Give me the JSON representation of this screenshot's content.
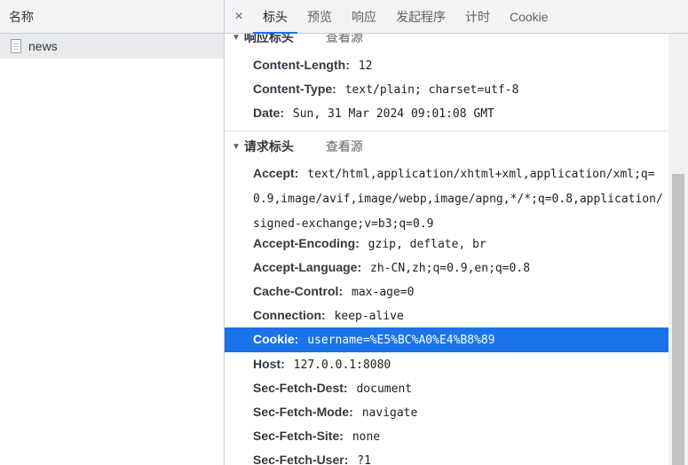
{
  "left": {
    "header": "名称",
    "items": [
      {
        "name": "news",
        "icon": "document-icon"
      }
    ]
  },
  "tabs": {
    "close": "×",
    "items": [
      "标头",
      "预览",
      "响应",
      "发起程序",
      "计时",
      "Cookie"
    ],
    "active": "标头"
  },
  "response_headers": {
    "title": "响应标头",
    "view_source": "查看源",
    "rows": [
      {
        "key": "Content-Length:",
        "value": "12"
      },
      {
        "key": "Content-Type:",
        "value": "text/plain; charset=utf-8"
      },
      {
        "key": "Date:",
        "value": "Sun, 31 Mar 2024 09:01:08 GMT"
      }
    ]
  },
  "request_headers": {
    "title": "请求标头",
    "view_source": "查看源",
    "rows": [
      {
        "key": "Accept:",
        "value": "text/html,application/xhtml+xml,application/xml;q=0.9,image/avif,image/webp,image/apng,*/*;q=0.8,application/signed-exchange;v=b3;q=0.9"
      },
      {
        "key": "Accept-Encoding:",
        "value": "gzip, deflate, br"
      },
      {
        "key": "Accept-Language:",
        "value": "zh-CN,zh;q=0.9,en;q=0.8"
      },
      {
        "key": "Cache-Control:",
        "value": "max-age=0"
      },
      {
        "key": "Connection:",
        "value": "keep-alive"
      },
      {
        "key": "Cookie:",
        "value": "username=%E5%BC%A0%E4%B8%89"
      },
      {
        "key": "Host:",
        "value": "127.0.0.1:8080"
      },
      {
        "key": "Sec-Fetch-Dest:",
        "value": "document"
      },
      {
        "key": "Sec-Fetch-Mode:",
        "value": "navigate"
      },
      {
        "key": "Sec-Fetch-Site:",
        "value": "none"
      },
      {
        "key": "Sec-Fetch-User:",
        "value": "?1"
      }
    ]
  },
  "colors": {
    "selected_row": "#1a73e8",
    "tab_indicator": "#1a73e8"
  }
}
